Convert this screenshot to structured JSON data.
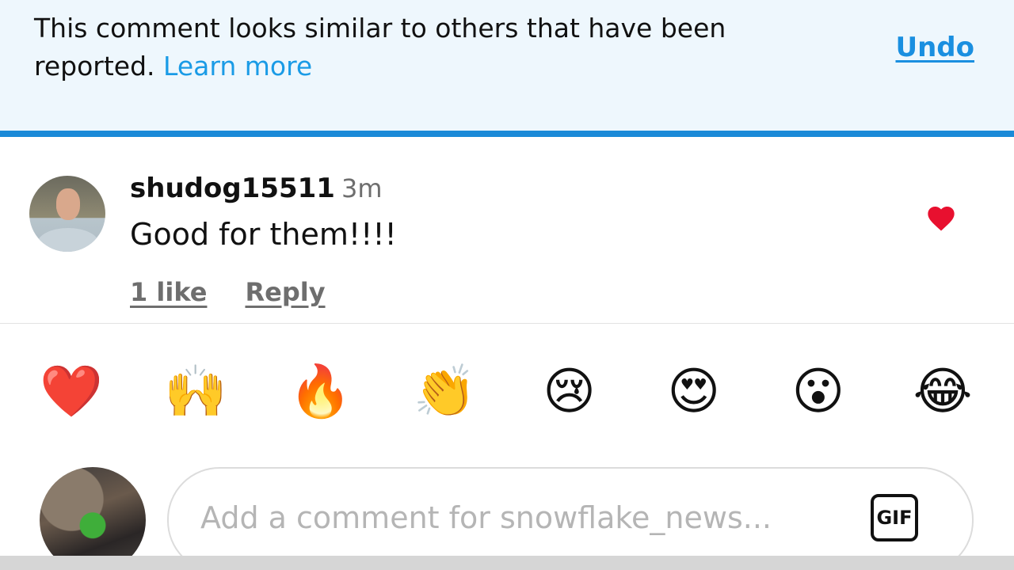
{
  "notice": {
    "message": "This comment looks similar to others that have been reported.",
    "learn_more_label": "Learn more",
    "undo_label": "Undo"
  },
  "comment": {
    "username": "shudog15511",
    "timestamp": "3m",
    "text": "Good for them!!!!",
    "likes_label": "1 like",
    "reply_label": "Reply",
    "liked": true
  },
  "reactions": [
    "❤️",
    "🙌",
    "🔥",
    "👏",
    "😢",
    "😍",
    "😮",
    "😂"
  ],
  "composer": {
    "placeholder": "Add a comment for snowflake_news...",
    "gif_label": "GIF"
  },
  "colors": {
    "accent": "#1a8ad8",
    "link": "#1a9be6",
    "heart": "#e8102f",
    "banner_bg": "#eef7fd"
  }
}
